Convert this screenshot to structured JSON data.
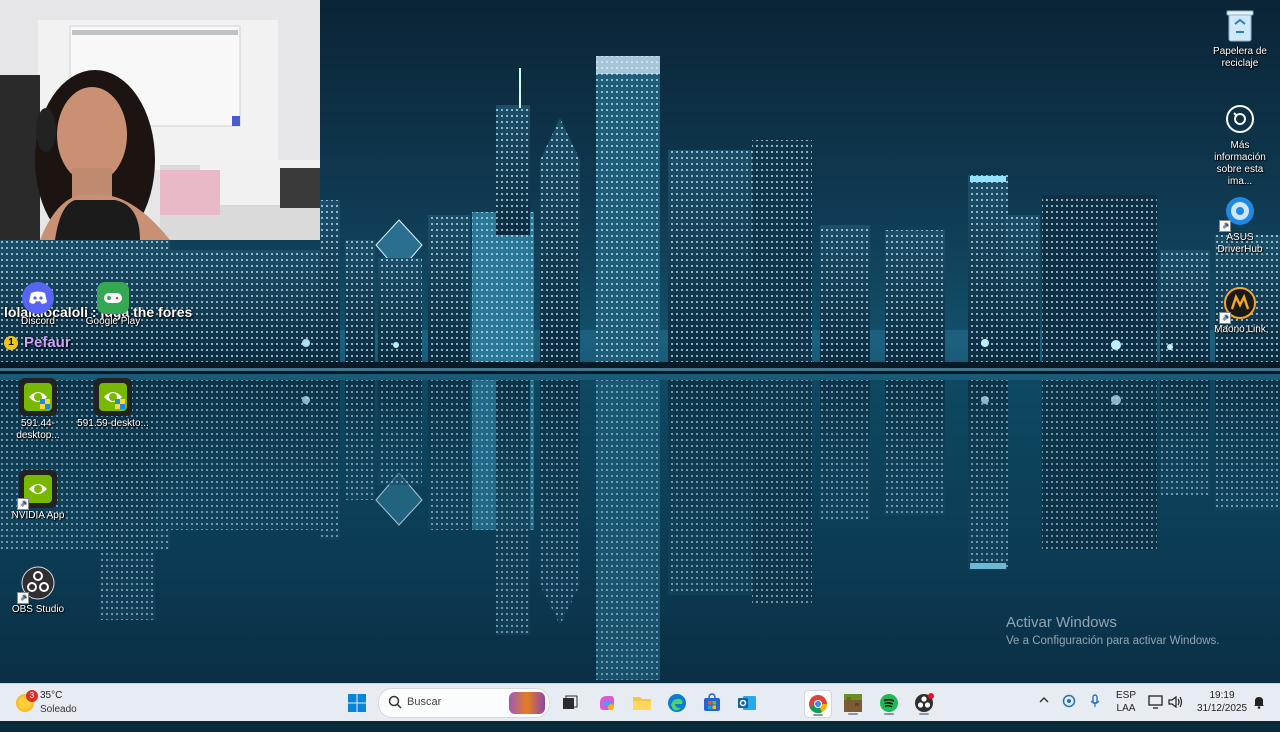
{
  "desktop": {
    "icons_left": [
      {
        "label": "Discord",
        "icon": "discord-icon"
      },
      {
        "label": "Google Play",
        "icon": "google-play-games-icon"
      },
      {
        "label": "591.44-desktop...",
        "icon": "nvidia-installer-icon"
      },
      {
        "label": "591.59-deskto...",
        "icon": "nvidia-installer-icon"
      },
      {
        "label": "NVIDIA App",
        "icon": "nvidia-app-icon"
      },
      {
        "label": "OBS Studio",
        "icon": "obs-studio-icon"
      }
    ],
    "icons_right": [
      {
        "label": "Papelera de reciclaje",
        "icon": "recycle-bin-icon"
      },
      {
        "label": "Más información sobre esta ima...",
        "icon": "info-camera-icon"
      },
      {
        "label": "ASUS DriverHub",
        "icon": "asus-driverhub-icon"
      },
      {
        "label": "Maono Link",
        "icon": "maono-link-icon"
      }
    ],
    "watermark": {
      "title": "Activar Windows",
      "subtitle": "Ve a Configuración para activar Windows."
    }
  },
  "stream_overlay": {
    "chat_line": "lolalalocaloli : juga the fores",
    "viewer_badge": "1",
    "viewer_name": "Pefaur"
  },
  "taskbar": {
    "weather": {
      "badge": "3",
      "temp": "35°C",
      "condition": "Soleado"
    },
    "search_placeholder": "Buscar",
    "apps": [
      {
        "name": "start-button",
        "icon": "windows-logo-icon"
      },
      {
        "name": "task-view",
        "icon": "task-view-icon"
      },
      {
        "name": "copilot",
        "icon": "copilot-icon"
      },
      {
        "name": "file-explorer",
        "icon": "folder-icon"
      },
      {
        "name": "edge",
        "icon": "edge-icon"
      },
      {
        "name": "store",
        "icon": "store-icon"
      },
      {
        "name": "outlook",
        "icon": "outlook-icon"
      },
      {
        "name": "chrome",
        "icon": "chrome-icon"
      },
      {
        "name": "minecraft",
        "icon": "minecraft-icon"
      },
      {
        "name": "spotify",
        "icon": "spotify-icon"
      },
      {
        "name": "obs",
        "icon": "obs-icon"
      }
    ],
    "tray": {
      "language": "ESP",
      "layout": "LAA",
      "time": "19:19",
      "date": "31/12/2025"
    }
  },
  "colors": {
    "accent": "#0078d4",
    "taskbar_bg": "#e7ecf2",
    "sky_dark": "#0b2436",
    "water": "#0e4a63"
  }
}
